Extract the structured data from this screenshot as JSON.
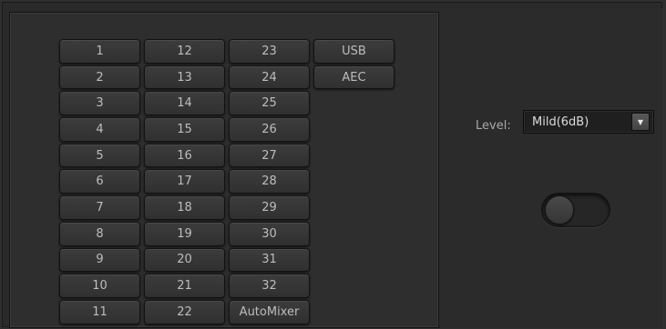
{
  "channels": {
    "col1": [
      "1",
      "2",
      "3",
      "4",
      "5",
      "6",
      "7",
      "8",
      "9",
      "10",
      "11"
    ],
    "col2": [
      "12",
      "13",
      "14",
      "15",
      "16",
      "17",
      "18",
      "19",
      "20",
      "21",
      "22"
    ],
    "col3": [
      "23",
      "24",
      "25",
      "26",
      "27",
      "28",
      "29",
      "30",
      "31",
      "32",
      "AutoMixer"
    ],
    "col4": [
      "USB",
      "AEC"
    ]
  },
  "level": {
    "label": "Level:",
    "value": "Mild(6dB)",
    "dropdown_icon": "triangle-down"
  },
  "toggle": {
    "state": "off"
  }
}
